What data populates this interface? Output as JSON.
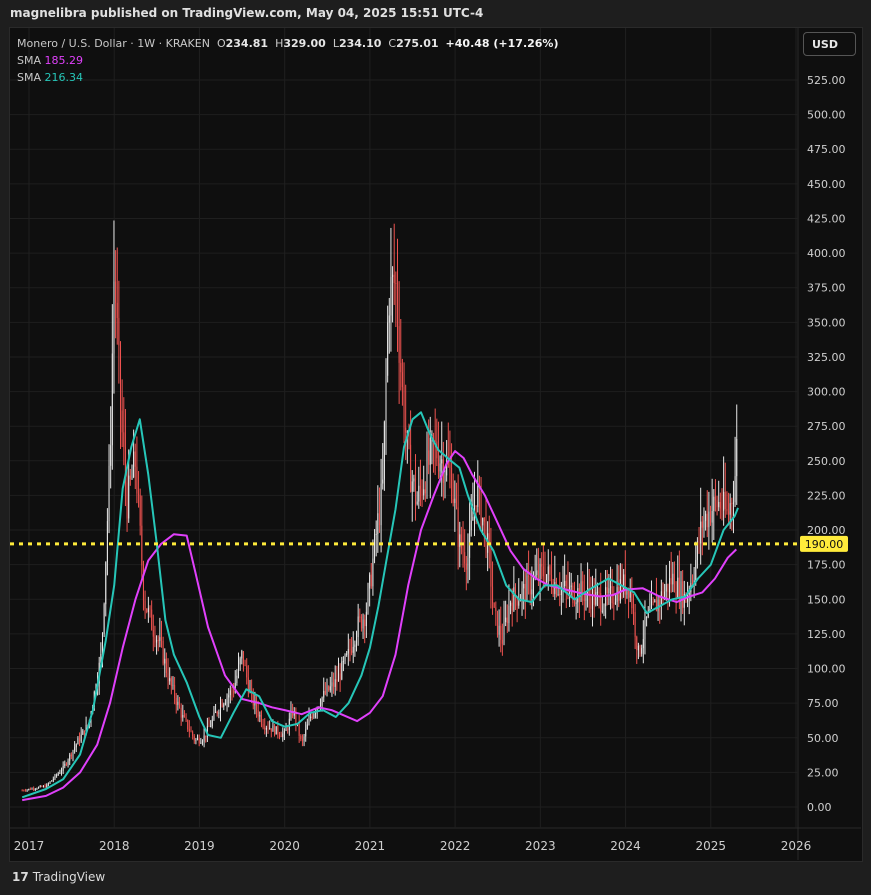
{
  "header": {
    "published": "magnelibra published on TradingView.com, May 04, 2025 15:51 UTC-4"
  },
  "legend": {
    "symbol": "Monero / U.S. Dollar · 1W · KRAKEN",
    "o_label": "O",
    "o_value": "234.81",
    "h_label": "H",
    "h_value": "329.00",
    "l_label": "L",
    "l_value": "234.10",
    "c_label": "C",
    "c_value": "275.01",
    "change": "+40.48 (+17.26%)",
    "sma1_label": "SMA",
    "sma1_value": "185.29",
    "sma2_label": "SMA",
    "sma2_value": "216.34"
  },
  "currency_button": "USD",
  "footer": {
    "logo": "17",
    "brand": "TradingView"
  },
  "colors": {
    "up": "#e8e8e8",
    "down": "#ef5350",
    "sma_long": "#e040fb",
    "sma_short": "#26c6b8",
    "level_line": "#ffeb3b",
    "axis_text": "#cfcfcf"
  },
  "chart_data": {
    "type": "line",
    "title": "Monero / U.S. Dollar · 1W · KRAKEN",
    "xlabel": "",
    "ylabel": "",
    "ylim": [
      -10,
      530
    ],
    "xlim": [
      2016.92,
      2026.0
    ],
    "grid": true,
    "x_ticks": [
      "2017",
      "2018",
      "2019",
      "2020",
      "2021",
      "2022",
      "2023",
      "2024",
      "2025",
      "2026"
    ],
    "y_ticks": [
      "0.00",
      "25.00",
      "50.00",
      "75.00",
      "100.00",
      "125.00",
      "150.00",
      "175.00",
      "200.00",
      "225.00",
      "250.00",
      "275.00",
      "300.00",
      "325.00",
      "350.00",
      "375.00",
      "400.00",
      "425.00",
      "450.00",
      "475.00",
      "500.00",
      "525.00"
    ],
    "horizontal_line": {
      "value": 190.0,
      "label": "190.00"
    },
    "price_path": {
      "x": [
        2016.92,
        2017.2,
        2017.4,
        2017.55,
        2017.7,
        2017.85,
        2017.95,
        2018.0,
        2018.08,
        2018.15,
        2018.25,
        2018.35,
        2018.45,
        2018.55,
        2018.65,
        2018.8,
        2018.95,
        2019.05,
        2019.15,
        2019.25,
        2019.4,
        2019.5,
        2019.6,
        2019.75,
        2019.9,
        2020.0,
        2020.1,
        2020.2,
        2020.3,
        2020.45,
        2020.6,
        2020.75,
        2020.85,
        2020.95,
        2021.0,
        2021.08,
        2021.15,
        2021.22,
        2021.3,
        2021.38,
        2021.45,
        2021.55,
        2021.65,
        2021.75,
        2021.85,
        2021.95,
        2022.05,
        2022.15,
        2022.25,
        2022.32,
        2022.4,
        2022.45,
        2022.55,
        2022.65,
        2022.8,
        2022.95,
        2023.05,
        2023.2,
        2023.35,
        2023.5,
        2023.65,
        2023.8,
        2023.95,
        2024.05,
        2024.15,
        2024.25,
        2024.4,
        2024.55,
        2024.7,
        2024.8,
        2024.9,
        2025.0,
        2025.1,
        2025.2,
        2025.28,
        2025.32
      ],
      "y": [
        12,
        15,
        28,
        45,
        60,
        110,
        250,
        390,
        280,
        220,
        250,
        150,
        130,
        115,
        90,
        65,
        48,
        50,
        62,
        75,
        85,
        110,
        80,
        60,
        55,
        52,
        70,
        45,
        65,
        80,
        90,
        110,
        130,
        140,
        160,
        200,
        230,
        370,
        380,
        300,
        250,
        220,
        240,
        260,
        250,
        240,
        190,
        180,
        230,
        210,
        180,
        140,
        120,
        150,
        155,
        165,
        170,
        160,
        155,
        155,
        150,
        150,
        160,
        160,
        110,
        135,
        150,
        165,
        150,
        170,
        205,
        215,
        220,
        210,
        235,
        275
      ]
    },
    "series": [
      {
        "name": "SMA",
        "label": "185.29",
        "color": "#e040fb",
        "x": [
          2016.92,
          2017.2,
          2017.4,
          2017.6,
          2017.8,
          2017.95,
          2018.1,
          2018.25,
          2018.4,
          2018.55,
          2018.7,
          2018.85,
          2018.95,
          2019.1,
          2019.3,
          2019.5,
          2019.7,
          2019.85,
          2020.0,
          2020.2,
          2020.4,
          2020.55,
          2020.7,
          2020.85,
          2021.0,
          2021.15,
          2021.3,
          2021.45,
          2021.6,
          2021.75,
          2021.9,
          2022.0,
          2022.1,
          2022.2,
          2022.35,
          2022.5,
          2022.65,
          2022.8,
          2022.95,
          2023.1,
          2023.3,
          2023.5,
          2023.7,
          2023.85,
          2024.0,
          2024.2,
          2024.4,
          2024.6,
          2024.75,
          2024.9,
          2025.05,
          2025.2,
          2025.3
        ],
        "y": [
          5,
          8,
          14,
          25,
          45,
          75,
          115,
          150,
          178,
          190,
          197,
          196,
          170,
          130,
          95,
          78,
          75,
          72,
          70,
          67,
          72,
          70,
          66,
          62,
          68,
          80,
          110,
          160,
          200,
          225,
          248,
          257,
          252,
          240,
          225,
          205,
          185,
          172,
          165,
          160,
          157,
          154,
          152,
          153,
          157,
          158,
          152,
          148,
          152,
          155,
          165,
          180,
          186
        ]
      },
      {
        "name": "SMA",
        "label": "216.34",
        "color": "#26c6b8",
        "x": [
          2016.92,
          2017.2,
          2017.4,
          2017.6,
          2017.75,
          2017.9,
          2018.0,
          2018.1,
          2018.2,
          2018.3,
          2018.4,
          2018.5,
          2018.6,
          2018.7,
          2018.85,
          2019.0,
          2019.1,
          2019.25,
          2019.4,
          2019.55,
          2019.7,
          2019.85,
          2020.0,
          2020.15,
          2020.3,
          2020.45,
          2020.6,
          2020.75,
          2020.9,
          2021.0,
          2021.1,
          2021.2,
          2021.3,
          2021.4,
          2021.5,
          2021.6,
          2021.7,
          2021.8,
          2021.95,
          2022.05,
          2022.15,
          2022.3,
          2022.45,
          2022.6,
          2022.75,
          2022.9,
          2023.05,
          2023.2,
          2023.4,
          2023.6,
          2023.8,
          2023.95,
          2024.1,
          2024.25,
          2024.4,
          2024.55,
          2024.7,
          2024.85,
          2025.0,
          2025.15,
          2025.28,
          2025.32
        ],
        "y": [
          7,
          13,
          20,
          38,
          70,
          120,
          160,
          230,
          260,
          280,
          240,
          190,
          135,
          110,
          90,
          65,
          52,
          50,
          68,
          85,
          80,
          62,
          58,
          60,
          68,
          70,
          65,
          75,
          95,
          115,
          145,
          180,
          215,
          260,
          280,
          285,
          270,
          258,
          250,
          245,
          225,
          200,
          185,
          160,
          150,
          148,
          160,
          160,
          150,
          158,
          165,
          160,
          155,
          140,
          145,
          150,
          152,
          165,
          175,
          200,
          210,
          216
        ]
      }
    ]
  }
}
